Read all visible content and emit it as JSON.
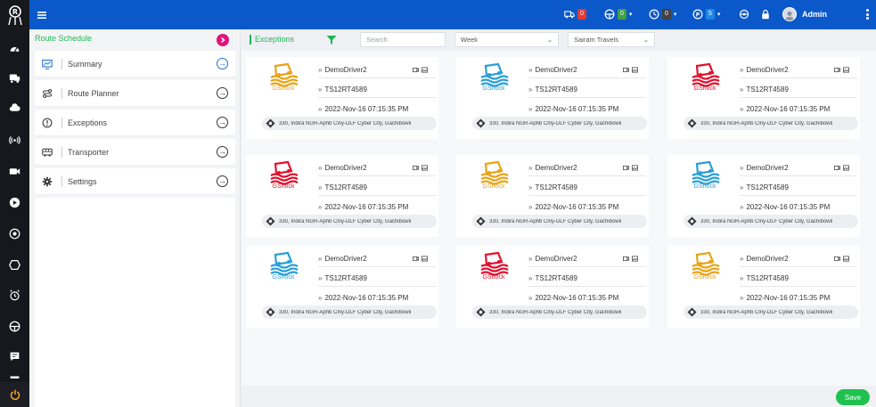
{
  "colors": {
    "topbar": "#0a58c9",
    "rail": "#16181d",
    "accent_green": "#1db954",
    "accent_pink": "#e0127d",
    "save_green": "#20c14f",
    "logo_orange": "#e8a317",
    "logo_blue": "#2a9fd6",
    "logo_red": "#e0122e"
  },
  "rail_icons": [
    "app-logo-icon",
    "dashboard-icon",
    "bus-icon",
    "cloud-icon",
    "broadcast-icon",
    "video-icon",
    "play-icon",
    "target-icon",
    "hexagon-icon",
    "alarm-clock-icon",
    "steering-icon",
    "chat-icon",
    "power-icon"
  ],
  "topbar": {
    "items": [
      {
        "name": "vehicle-alerts",
        "icon": "truck-icon",
        "count": "0",
        "badge_color": "#e53935"
      },
      {
        "name": "online-status",
        "icon": "steering-icon",
        "count": "0",
        "badge_color": "#43a047"
      },
      {
        "name": "idle-status",
        "icon": "clock-icon",
        "count": "0",
        "badge_color": "#424242"
      },
      {
        "name": "parking-status",
        "icon": "parking-icon",
        "count": "5",
        "badge_color": "#1e88e5"
      }
    ],
    "user": {
      "name": "Admin"
    }
  },
  "left_panel": {
    "title": "Route Schedule",
    "menu": [
      {
        "label": "Summary",
        "icon": "monitor-chart-icon",
        "active": true
      },
      {
        "label": "Route Planner",
        "icon": "route-icon",
        "active": false
      },
      {
        "label": "Exceptions",
        "icon": "alert-circle-icon",
        "active": false
      },
      {
        "label": "Transporter",
        "icon": "bus-icon",
        "active": false
      },
      {
        "label": "Settings",
        "icon": "gear-icon",
        "active": false
      }
    ]
  },
  "main": {
    "title": "Exceptions",
    "search": {
      "placeholder": "Search"
    },
    "period": {
      "value": "Week"
    },
    "company": {
      "value": "Sairam Travels"
    }
  },
  "cards": [
    {
      "color": "orange",
      "logo_text": "GShock",
      "driver": "DemoDriver2",
      "vehicle": "TS12RT4589",
      "datetime": "2022-Nov-16 07:15:35 PM",
      "address": "330, Indira NGR-Aphb Clny-DLF Cyber City, Gachibowli"
    },
    {
      "color": "blue",
      "logo_text": "GShock",
      "driver": "DemoDriver2",
      "vehicle": "TS12RT4589",
      "datetime": "2022-Nov-16 07:15:35 PM",
      "address": "330, Indira NGR-Aphb Clny-DLF Cyber City, Gachibowli"
    },
    {
      "color": "red",
      "logo_text": "GShock",
      "driver": "DemoDriver2",
      "vehicle": "TS12RT4589",
      "datetime": "2022-Nov-16 07:15:35 PM",
      "address": "330, Indira NGR-Aphb Clny-DLF Cyber City, Gachibowli"
    },
    {
      "color": "red",
      "logo_text": "GShock",
      "driver": "DemoDriver2",
      "vehicle": "TS12RT4589",
      "datetime": "2022-Nov-16 07:15:35 PM",
      "address": "330, Indira NGR-Aphb Clny-DLF Cyber City, Gachibowli"
    },
    {
      "color": "orange",
      "logo_text": "GShock",
      "driver": "DemoDriver2",
      "vehicle": "TS12RT4589",
      "datetime": "2022-Nov-16 07:15:35 PM",
      "address": "330, Indira NGR-Aphb Clny-DLF Cyber City, Gachibowli"
    },
    {
      "color": "blue",
      "logo_text": "GShock",
      "driver": "DemoDriver2",
      "vehicle": "TS12RT4589",
      "datetime": "2022-Nov-16 07:15:35 PM",
      "address": "330, Indira NGR-Aphb Clny-DLF Cyber City, Gachibowli"
    },
    {
      "color": "blue",
      "logo_text": "GShock",
      "driver": "DemoDriver2",
      "vehicle": "TS12RT4589",
      "datetime": "2022-Nov-16 07:15:35 PM",
      "address": "330, Indira NGR-Aphb Clny-DLF Cyber City, Gachibowli"
    },
    {
      "color": "red",
      "logo_text": "GShock",
      "driver": "DemoDriver2",
      "vehicle": "TS12RT4589",
      "datetime": "2022-Nov-16 07:15:35 PM",
      "address": "330, Indira NGR-Aphb Clny-DLF Cyber City, Gachibowli"
    },
    {
      "color": "orange",
      "logo_text": "GShock",
      "driver": "DemoDriver2",
      "vehicle": "TS12RT4589",
      "datetime": "2022-Nov-16 07:15:35 PM",
      "address": "330, Indira NGR-Aphb Clny-DLF Cyber City, Gachibowli"
    }
  ],
  "footer": {
    "save_label": "Save"
  }
}
